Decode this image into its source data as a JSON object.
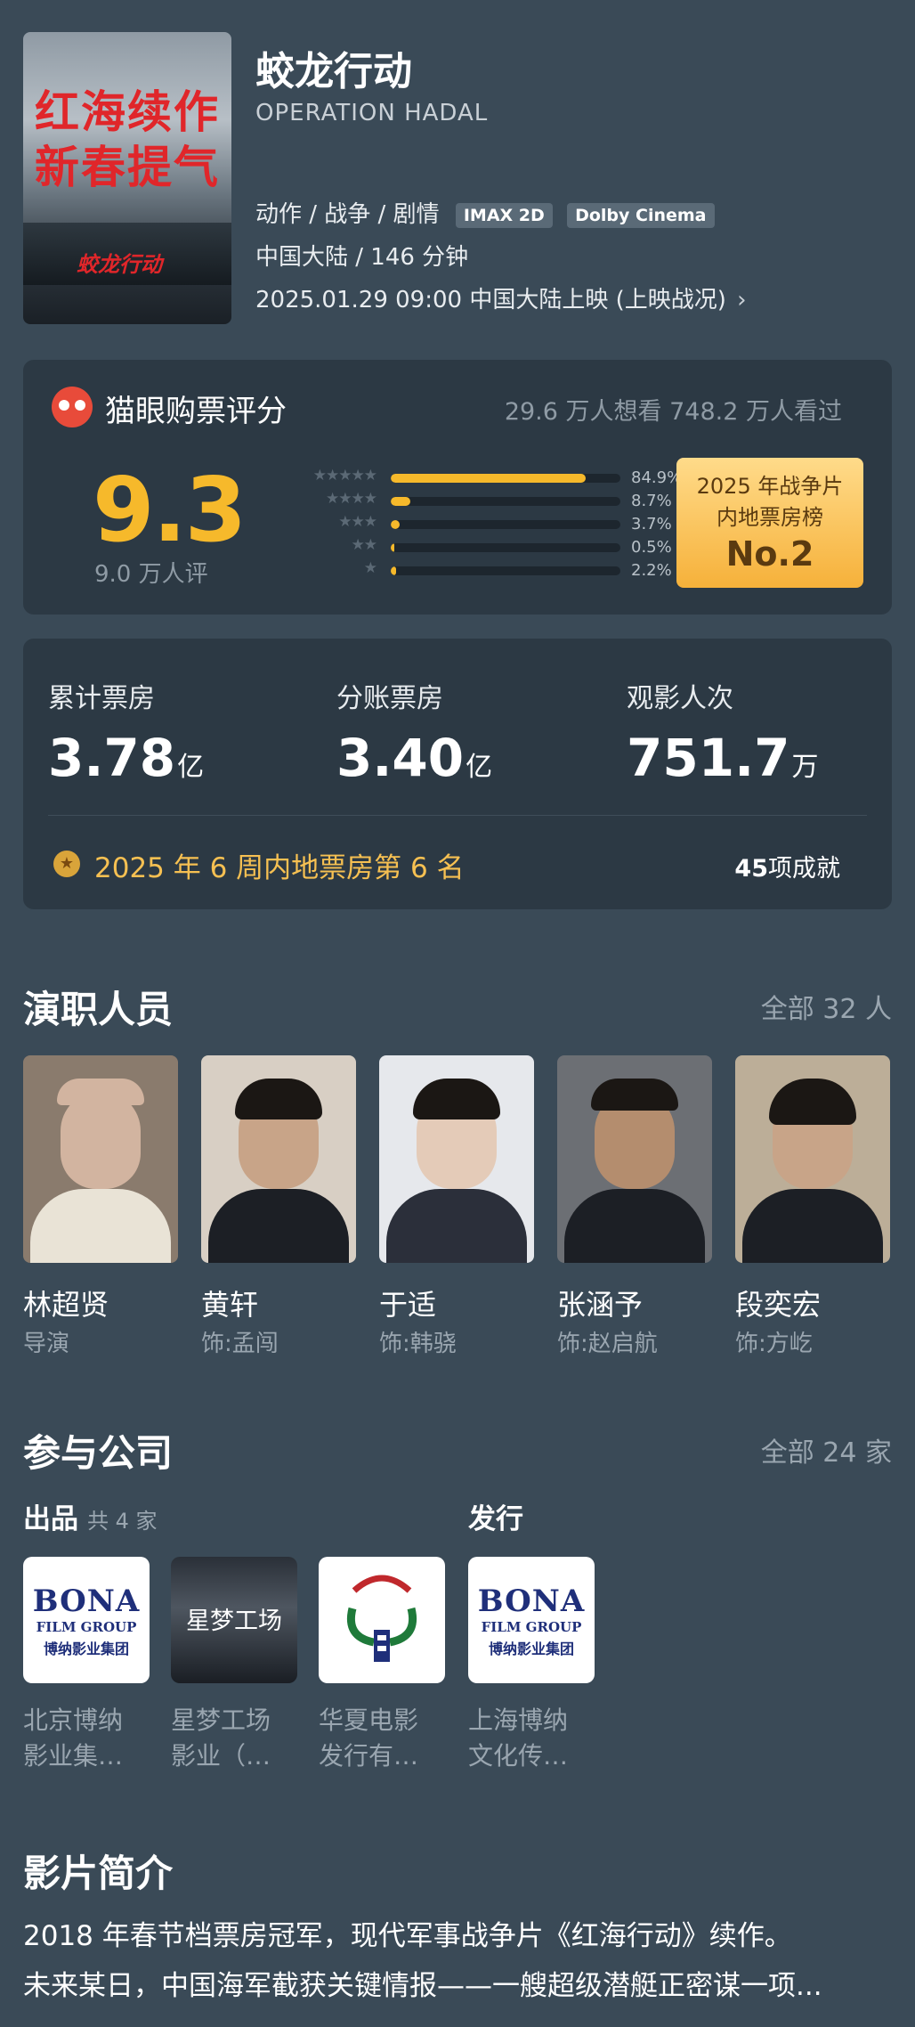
{
  "movie": {
    "title": "蛟龙行动",
    "title_en": "OPERATION HADAL",
    "genres": "动作 / 战争 / 剧情",
    "tags": [
      "IMAX 2D",
      "Dolby Cinema"
    ],
    "region_duration": "中国大陆 / 146 分钟",
    "release": "2025.01.29 09:00 中国大陆上映 (上映战况)",
    "poster": {
      "line1": "红海续作",
      "line2": "新春提气",
      "logo": "蛟龙行动"
    }
  },
  "rating": {
    "title": "猫眼购票评分",
    "counts": "29.6 万人想看  748.2 万人看过",
    "score": "9.3",
    "score_count": "9.0 万人评",
    "distribution": [
      {
        "stars": "★★★★★",
        "pct_label": "84.9%",
        "value": 84.9
      },
      {
        "stars": "★★★★",
        "pct_label": "8.7%",
        "value": 8.7
      },
      {
        "stars": "★★★",
        "pct_label": "3.7%",
        "value": 3.7
      },
      {
        "stars": "★★",
        "pct_label": "0.5%",
        "value": 0.5
      },
      {
        "stars": "★",
        "pct_label": "2.2%",
        "value": 2.2
      }
    ],
    "rank_line1": "2025 年战争片",
    "rank_line2": "内地票房榜",
    "rank_no": "No.2"
  },
  "boxoffice": {
    "stats": [
      {
        "label": "累计票房",
        "value": "3.78",
        "unit": "亿"
      },
      {
        "label": "分账票房",
        "value": "3.40",
        "unit": "亿"
      },
      {
        "label": "观影人次",
        "value": "751.7",
        "unit": "万"
      }
    ],
    "rank_text": "2025 年 6 周内地票房第 6 名",
    "achieve_count": "45",
    "achieve_label": "项成就"
  },
  "cast": {
    "title": "演职人员",
    "more": "全部 32 人",
    "members": [
      {
        "name": "林超贤",
        "role": "导演"
      },
      {
        "name": "黄轩",
        "role": "饰:孟闯"
      },
      {
        "name": "于适",
        "role": "饰:韩骁"
      },
      {
        "name": "张涵予",
        "role": "饰:赵启航"
      },
      {
        "name": "段奕宏",
        "role": "饰:方屹"
      }
    ]
  },
  "companies": {
    "title": "参与公司",
    "more": "全部 24 家",
    "produce_label": "出品",
    "produce_count": "共 4 家",
    "distribute_label": "发行",
    "items": [
      {
        "name_l1": "北京博纳",
        "name_l2": "影业集…",
        "logo": "BONA"
      },
      {
        "name_l1": "星梦工场",
        "name_l2": "影业（…",
        "logo": "星梦工场"
      },
      {
        "name_l1": "华夏电影",
        "name_l2": "发行有…",
        "logo": ""
      },
      {
        "name_l1": "上海博纳",
        "name_l2": "文化传…",
        "logo": "BONA"
      }
    ],
    "bona_sub": "FILM GROUP",
    "bona_cn": "博纳影业集团"
  },
  "intro": {
    "title": "影片简介",
    "line1": "2018 年春节档票房冠军，现代军事战争片《红海行动》续作。",
    "line2": "未来某日，中国海军截获关键情报——一艘超级潜艇正密谋一项..."
  },
  "colors": {
    "background": "#3a4a57",
    "card": "#2c3944",
    "accent": "#f6b92b"
  }
}
